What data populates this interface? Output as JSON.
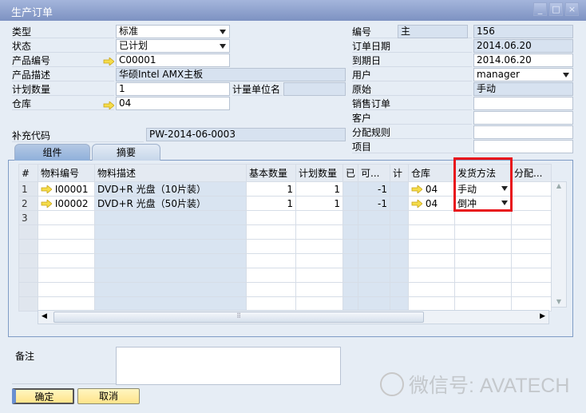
{
  "window": {
    "title": "生产订单"
  },
  "left": {
    "type": {
      "label": "类型",
      "value": "标准"
    },
    "status": {
      "label": "状态",
      "value": "已计划"
    },
    "product_no": {
      "label": "产品编号",
      "value": "C00001"
    },
    "product_desc": {
      "label": "产品描述",
      "value": "华硕Intel AMX主板"
    },
    "planned_qty": {
      "label": "计划数量",
      "value": "1"
    },
    "uom_name": {
      "label": "计量单位名",
      "value": ""
    },
    "warehouse": {
      "label": "仓库",
      "value": "04"
    },
    "supp_code": {
      "label": "补充代码",
      "value": "PW-2014-06-0003"
    }
  },
  "right": {
    "number": {
      "label": "编号",
      "series": "主",
      "value": "156"
    },
    "order_date": {
      "label": "订单日期",
      "value": "2014.06.20"
    },
    "due_date": {
      "label": "到期日",
      "value": "2014.06.20"
    },
    "user": {
      "label": "用户",
      "value": "manager"
    },
    "origin": {
      "label": "原始",
      "value": "手动"
    },
    "sales_order": {
      "label": "销售订单",
      "value": ""
    },
    "customer": {
      "label": "客户",
      "value": ""
    },
    "dist_rule": {
      "label": "分配规则",
      "value": ""
    },
    "project": {
      "label": "项目",
      "value": ""
    }
  },
  "tabs": [
    "组件",
    "摘要"
  ],
  "grid": {
    "headers": [
      "#",
      "物料编号",
      "物料描述",
      "基本数量",
      "计划数量",
      "已",
      "可...",
      "计",
      "仓库",
      "发货方法",
      "分配..."
    ],
    "rows": [
      {
        "n": "1",
        "item": "I00001",
        "desc": "DVD+R 光盘（10片装）",
        "base": "1",
        "planned": "1",
        "avail": "-1",
        "wh": "04",
        "method": "手动"
      },
      {
        "n": "2",
        "item": "I00002",
        "desc": "DVD+R 光盘（50片装）",
        "base": "1",
        "planned": "1",
        "avail": "-1",
        "wh": "04",
        "method": "倒冲"
      },
      {
        "n": "3"
      }
    ]
  },
  "remarks": {
    "label": "备注",
    "value": ""
  },
  "buttons": {
    "ok": "确定",
    "cancel": "取消"
  },
  "watermark": "微信号: AVATECH",
  "colors": {
    "highlight": "#e8141b",
    "arrow": "#f2d33a"
  }
}
